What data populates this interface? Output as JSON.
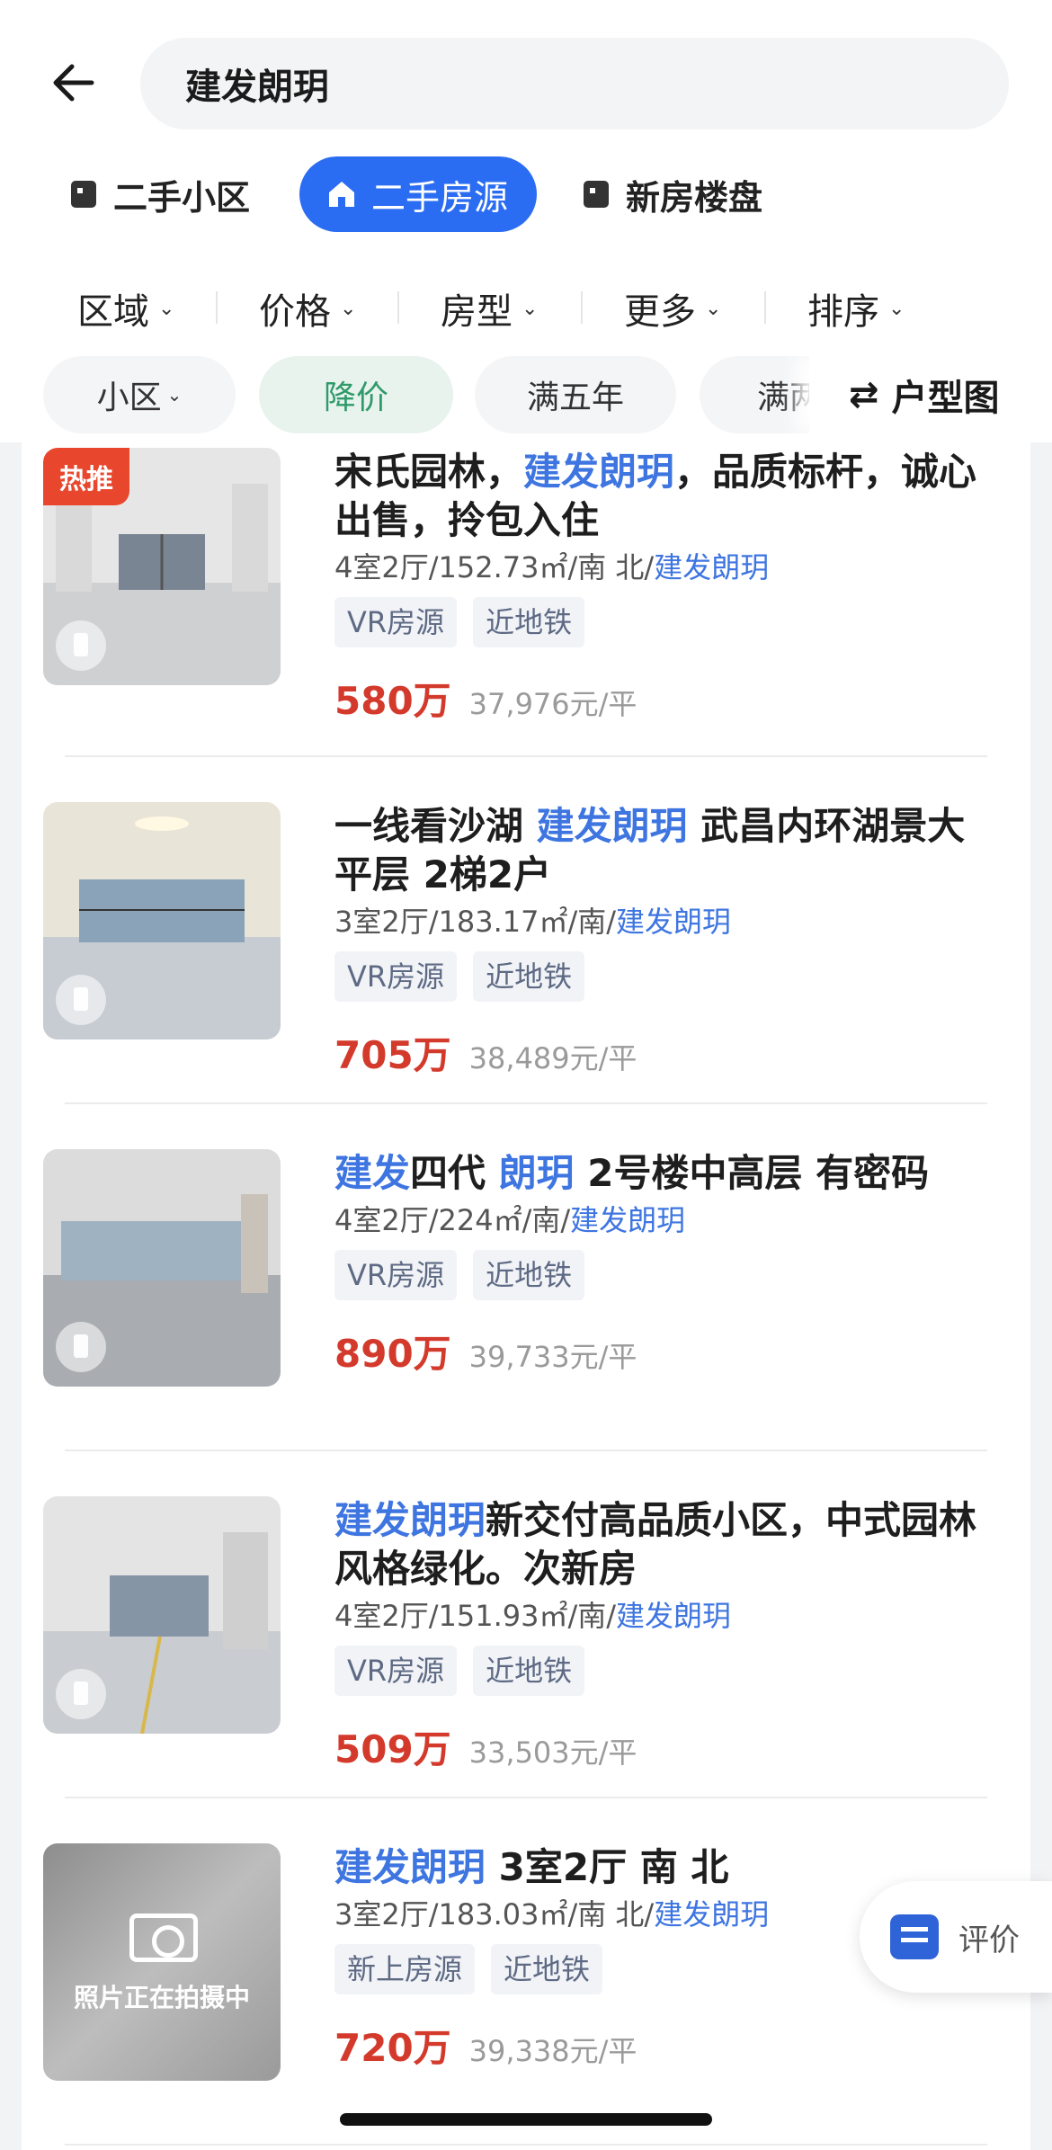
{
  "search": {
    "query": "建发朗玥"
  },
  "category_tabs": [
    {
      "label": "二手小区",
      "active": false
    },
    {
      "label": "二手房源",
      "active": true
    },
    {
      "label": "新房楼盘",
      "active": false
    }
  ],
  "filters": [
    "区域",
    "价格",
    "房型",
    "更多",
    "排序"
  ],
  "chips": [
    {
      "label": "小区",
      "has_dropdown": true,
      "selected": false
    },
    {
      "label": "降价",
      "has_dropdown": false,
      "selected": true
    },
    {
      "label": "满五年",
      "has_dropdown": false,
      "selected": false
    },
    {
      "label": "满两",
      "has_dropdown": false,
      "selected": false
    }
  ],
  "floorplan_button": {
    "label": "户型图",
    "icon": "swap-arrows-icon"
  },
  "listings": [
    {
      "badge": "热推",
      "title_parts": [
        {
          "text": "宋氏园林，",
          "hl": false
        },
        {
          "text": "建发朗玥",
          "hl": true
        },
        {
          "text": "，品质标杆，诚心出售，拎包入住",
          "hl": false
        }
      ],
      "meta": "4室2厅/152.73㎡/南 北/",
      "community": "建发朗玥",
      "tags": [
        "VR房源",
        "近地铁"
      ],
      "price": "580万",
      "unit_price": "37,976元/平",
      "photo_placeholder": false
    },
    {
      "badge": "",
      "title_parts": [
        {
          "text": "一线看沙湖 ",
          "hl": false
        },
        {
          "text": "建发朗玥",
          "hl": true
        },
        {
          "text": " 武昌内环湖景大平层 2梯2户",
          "hl": false
        }
      ],
      "meta": "3室2厅/183.17㎡/南/",
      "community": "建发朗玥",
      "tags": [
        "VR房源",
        "近地铁"
      ],
      "price": "705万",
      "unit_price": "38,489元/平",
      "photo_placeholder": false
    },
    {
      "badge": "",
      "title_parts": [
        {
          "text": "建发",
          "hl": true
        },
        {
          "text": "四代 ",
          "hl": false
        },
        {
          "text": "朗玥",
          "hl": true
        },
        {
          "text": " 2号楼中高层 有密码",
          "hl": false
        }
      ],
      "meta": "4室2厅/224㎡/南/",
      "community": "建发朗玥",
      "tags": [
        "VR房源",
        "近地铁"
      ],
      "price": "890万",
      "unit_price": "39,733元/平",
      "photo_placeholder": false
    },
    {
      "badge": "",
      "title_parts": [
        {
          "text": "建发朗玥",
          "hl": true
        },
        {
          "text": "新交付高品质小区，中式园林风格绿化。次新房",
          "hl": false
        }
      ],
      "meta": "4室2厅/151.93㎡/南/",
      "community": "建发朗玥",
      "tags": [
        "VR房源",
        "近地铁"
      ],
      "price": "509万",
      "unit_price": "33,503元/平",
      "photo_placeholder": false
    },
    {
      "badge": "",
      "title_parts": [
        {
          "text": "建发朗玥",
          "hl": true
        },
        {
          "text": " 3室2厅 南 北",
          "hl": false
        }
      ],
      "meta": "3室2厅/183.03㎡/南 北/",
      "community": "建发朗玥",
      "tags": [
        "新上房源",
        "近地铁"
      ],
      "price": "720万",
      "unit_price": "39,338元/平",
      "photo_placeholder": true,
      "placeholder_text": "照片正在拍摄中"
    }
  ],
  "review_button": {
    "label": "评价"
  },
  "colors": {
    "accent": "#2b6df2",
    "price": "#d33a2c",
    "highlight": "#3e75e0",
    "hot_badge": "#e8472e"
  }
}
